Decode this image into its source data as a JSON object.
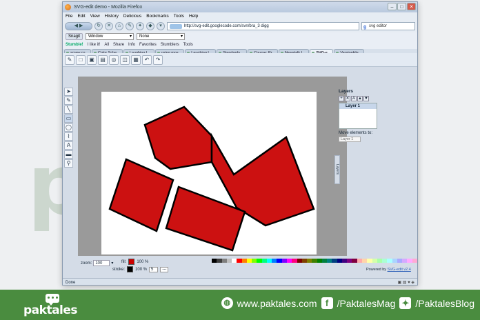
{
  "watermark": "paktales",
  "browser": {
    "title": "SVG-edit demo - Mozilla Firefox",
    "controls": {
      "minimize": "–",
      "maximize": "□",
      "close": "✕"
    },
    "menu": [
      "File",
      "Edit",
      "View",
      "History",
      "Delicious",
      "Bookmarks",
      "Tools",
      "Help"
    ],
    "url": "http://svg-edit.googlecode.com/svn/bra_3 digg",
    "search": "svg editor",
    "snagit": "Snagit",
    "window_select": "Window",
    "none_select": "None",
    "bookmarks": [
      "Stumble!",
      "I like it!",
      "All",
      "Share",
      "Info",
      "Favorites",
      "Stumblers",
      "Tools"
    ],
    "tabs": [
      "screw.co...",
      "Color Sche...",
      "Laughing L...",
      "using mos...",
      "Laughing L...",
      "Standards ...",
      "Course: Pr...",
      "Newstalk L...",
      "SVG-e...",
      "VersionHis..."
    ],
    "active_tab_index": 8,
    "status": "Done"
  },
  "svgedit": {
    "layers_label": "Layers",
    "layer_name": "Layer 1",
    "move_label": "Move elements to:",
    "move_select": "Layer 1",
    "layers_tab": "Layers",
    "zoom_label": "zoom:",
    "zoom_value": "100",
    "fill_label": "fill:",
    "fill_color": "#cc0000",
    "fill_opacity": "100 %",
    "stroke_label": "stroke:",
    "stroke_color": "#000000",
    "stroke_opacity": "100 %",
    "stroke_width": "5",
    "stroke_dash": "---",
    "powered_by": "Powered by",
    "powered_link": "SVG-edit v2.4",
    "palette": [
      "#000000",
      "#3f3f3f",
      "#7f7f7f",
      "#bfbfbf",
      "#ffffff",
      "#ff0000",
      "#ff7f00",
      "#ffff00",
      "#7fff00",
      "#00ff00",
      "#00ff7f",
      "#00ffff",
      "#007fff",
      "#0000ff",
      "#7f00ff",
      "#ff00ff",
      "#ff007f",
      "#7f0000",
      "#7f3f00",
      "#7f7f00",
      "#3f7f00",
      "#007f00",
      "#007f3f",
      "#007f7f",
      "#003f7f",
      "#00007f",
      "#3f007f",
      "#7f007f",
      "#7f003f",
      "#ffaaaa",
      "#ffd4aa",
      "#ffffaa",
      "#d4ffaa",
      "#aaffaa",
      "#aaffd4",
      "#aaffff",
      "#aad4ff",
      "#aaaaff",
      "#d4aaff",
      "#ffaaff",
      "#ffaad4"
    ]
  },
  "footer": {
    "logo": "paktales",
    "website": "www.paktales.com",
    "facebook": "/PaktalesMag",
    "twitter": "/PaktalesBlog",
    "brand_color": "#4a8c3f"
  }
}
